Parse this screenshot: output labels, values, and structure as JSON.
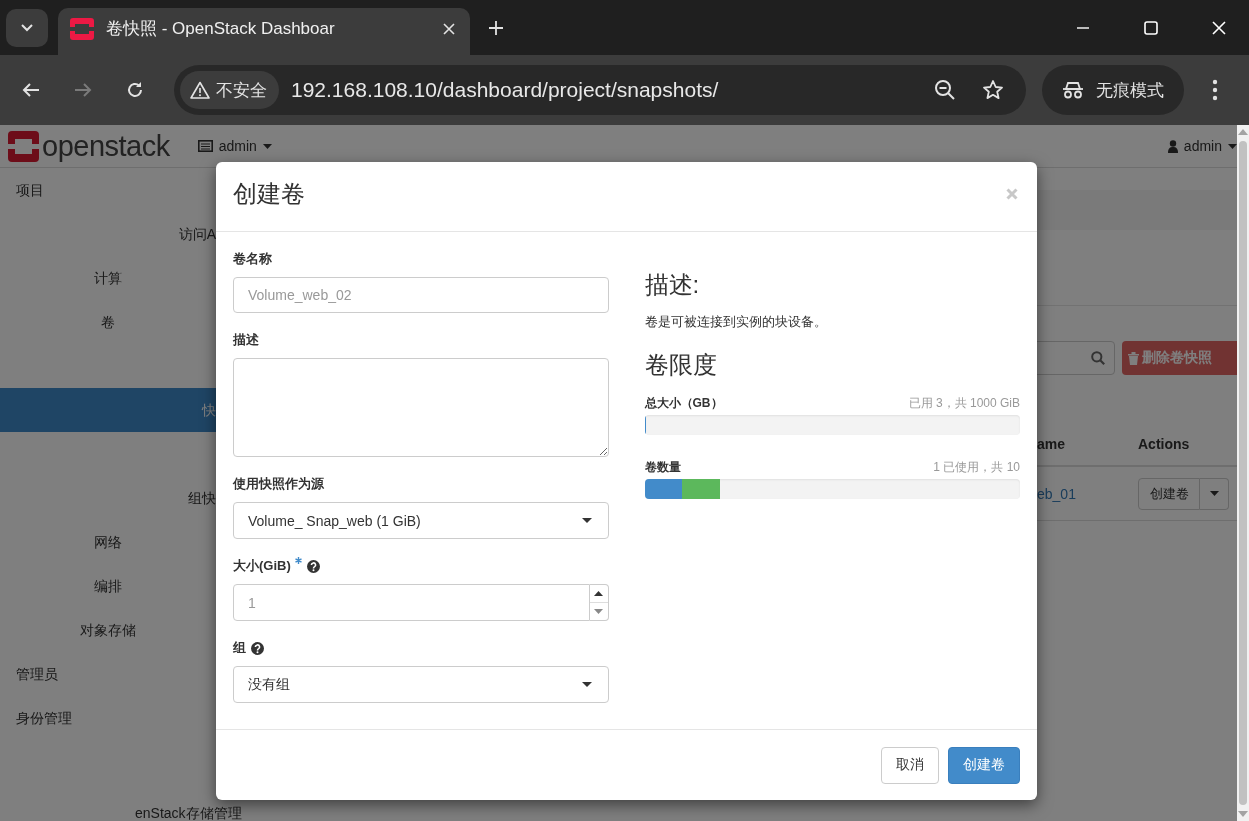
{
  "browser": {
    "tabs": [
      {
        "title": "卷快照 - OpenStack Dashboar",
        "selected": true
      }
    ],
    "forward_disabled": true,
    "security_chip": "不安全",
    "url": "192.168.108.10/dashboard/project/snapshots/",
    "profile_chip": "无痕模式"
  },
  "header": {
    "logo": "openstack",
    "project": "admin",
    "user": "admin"
  },
  "sidebar": {
    "items": [
      {
        "label": "项目",
        "kind": "dashboard",
        "children": [
          {
            "label": "访问A",
            "kind": "panel",
            "selected": false
          },
          {
            "label": "计算",
            "kind": "group"
          },
          {
            "label": "卷",
            "kind": "group",
            "children": [
              {
                "kind": "covered"
              },
              {
                "label": "快",
                "kind": "panel",
                "selected": true
              },
              {
                "kind": "covered"
              },
              {
                "label": "组快",
                "kind": "panel",
                "selected": false
              }
            ]
          },
          {
            "label": "网络",
            "kind": "group"
          },
          {
            "label": "编排",
            "kind": "group"
          },
          {
            "label": "对象存储",
            "kind": "group"
          }
        ]
      },
      {
        "label": "管理员",
        "kind": "dashboard"
      },
      {
        "label": "身份管理",
        "kind": "dashboard"
      }
    ],
    "footer": "enStack存储管理"
  },
  "content": {
    "delete_button": "删除卷快照",
    "table": {
      "columns": [
        "ame",
        "Actions"
      ],
      "rows": [
        {
          "name": "eb_01",
          "action": "创建卷"
        }
      ]
    }
  },
  "modal": {
    "title": "创建卷",
    "fields": [
      {
        "kind": "text",
        "label": "卷名称",
        "placeholder": "Volume_web_02"
      },
      {
        "kind": "textarea",
        "label": "描述"
      },
      {
        "kind": "select",
        "label": "使用快照作为源",
        "value": "Volume_ Snap_web (1 GiB)"
      },
      {
        "kind": "number",
        "label": "大小(GiB)",
        "required": true,
        "help": true,
        "placeholder": "1"
      },
      {
        "kind": "select",
        "label": "组",
        "help": true,
        "value": "没有组"
      }
    ],
    "description": {
      "heading": "描述:",
      "text": "卷是可被连接到实例的块设备。"
    },
    "limits": {
      "heading": "卷限度",
      "meters": [
        {
          "label": "总大小（GB）",
          "reading": "已用 3，共 1000 GiB",
          "segments": [
            {
              "level": 0.003,
              "color": "#428bca"
            }
          ]
        },
        {
          "label": "卷数量",
          "reading": "1 已使用，共 10",
          "segments": [
            {
              "level": 0.1,
              "color": "#428bca"
            },
            {
              "level": 0.1,
              "color": "#5cb85c"
            }
          ]
        }
      ]
    },
    "buttons": [
      {
        "label": "取消",
        "kind": "default"
      },
      {
        "label": "创建卷",
        "kind": "primary"
      }
    ]
  }
}
